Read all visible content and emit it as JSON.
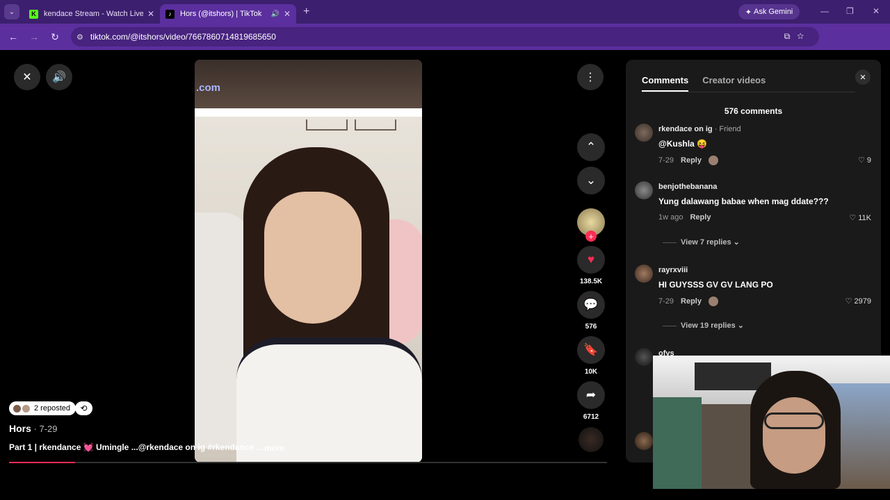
{
  "browser": {
    "tabs": [
      {
        "title": "kendace Stream - Watch Live o",
        "favicon": "K",
        "active": false
      },
      {
        "title": "Hors (@itshors) | TikTok",
        "favicon": "♪",
        "active": true
      }
    ],
    "gemini_label": "Ask Gemini",
    "url": "tiktok.com/@itshors/video/7667860714819685650"
  },
  "video": {
    "watermark": ".com",
    "progress_pct": 11
  },
  "caption": {
    "reposts": "2 reposted",
    "author": "Hors",
    "date": " · 7-29",
    "description": "Part 1 | rkendance 💓 Umingle ...@rkendace on ig #rkendance ...",
    "more": "more"
  },
  "actions": {
    "likes": "138.5K",
    "comments": "576",
    "saves": "10K",
    "shares": "6712"
  },
  "comments_panel": {
    "tab_comments": "Comments",
    "tab_creator": "Creator videos",
    "count": "576 comments",
    "items": [
      {
        "user": "rkendace on ig",
        "tag": " · Friend",
        "text": "@Kushla 😝",
        "time": "7-29",
        "reply": "Reply",
        "likes": "♡ 9"
      },
      {
        "user": "benjothebanana",
        "tag": "",
        "text": "Yung dalawang babae when mag ddate???",
        "time": "1w ago",
        "reply": "Reply",
        "likes": "♡ 11K"
      },
      {
        "user": "rayrxviii",
        "tag": "",
        "text": "HI GUYSSS GV GV LANG PO",
        "time": "7-29",
        "reply": "Reply",
        "likes": "♡ 2979"
      },
      {
        "user": "ofys",
        "tag": "",
        "text": "",
        "time": "",
        "reply": "",
        "likes": ""
      }
    ],
    "view_replies_1": "View 7 replies ⌄",
    "view_replies_2": "View 19 replies ⌄"
  }
}
